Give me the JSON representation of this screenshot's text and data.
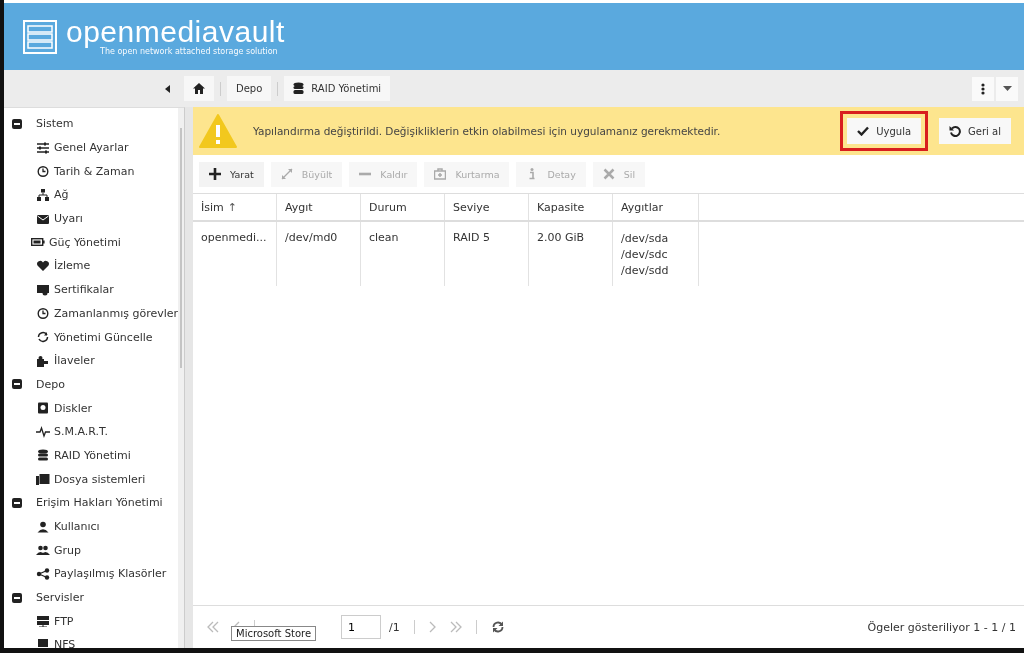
{
  "header": {
    "logo": "openmediavault",
    "tagline": "The open network attached storage solution"
  },
  "breadcrumb": [
    {
      "kind": "home"
    },
    {
      "kind": "text",
      "label": "Depo"
    },
    {
      "kind": "icon",
      "label": "RAID Yönetimi"
    }
  ],
  "sidebar": {
    "groups": [
      {
        "label": "Sistem",
        "expanded": true,
        "children": [
          {
            "label": "Genel Ayarlar"
          },
          {
            "label": "Tarih & Zaman"
          },
          {
            "label": "Ağ"
          },
          {
            "label": "Uyarı"
          },
          {
            "label": "Güç Yönetimi"
          },
          {
            "label": "İzleme"
          },
          {
            "label": "Sertifikalar"
          },
          {
            "label": "Zamanlanmış görevler"
          },
          {
            "label": "Yönetimi Güncelle"
          },
          {
            "label": "İlaveler"
          }
        ]
      },
      {
        "label": "Depo",
        "expanded": true,
        "children": [
          {
            "label": "Diskler"
          },
          {
            "label": "S.M.A.R.T."
          },
          {
            "label": "RAID Yönetimi"
          },
          {
            "label": "Dosya sistemleri"
          }
        ]
      },
      {
        "label": "Erişim Hakları Yönetimi",
        "expanded": true,
        "children": [
          {
            "label": "Kullanıcı"
          },
          {
            "label": "Grup"
          },
          {
            "label": "Paylaşılmış Klasörler"
          }
        ]
      },
      {
        "label": "Servisler",
        "expanded": true,
        "children": [
          {
            "label": "FTP"
          },
          {
            "label": "NFS"
          }
        ]
      }
    ]
  },
  "notice": {
    "message": "Yapılandırma değiştirildi. Değişikliklerin etkin olabilmesi için uygulamanız gerekmektedir.",
    "buttons": [
      {
        "label": "Uygula",
        "highlighted": true
      },
      {
        "label": "Geri al",
        "highlighted": false
      }
    ]
  },
  "toolbar": [
    {
      "label": "Yarat",
      "disabled": false
    },
    {
      "label": "Büyült",
      "disabled": true
    },
    {
      "label": "Kaldır",
      "disabled": true
    },
    {
      "label": "Kurtarma",
      "disabled": true
    },
    {
      "label": "Detay",
      "disabled": true
    },
    {
      "label": "Sil",
      "disabled": true
    }
  ],
  "table": {
    "columns": [
      "İsim",
      "Aygıt",
      "Durum",
      "Seviye",
      "Kapasite",
      "Aygıtlar"
    ],
    "sort_icon": "↑",
    "rows": [
      {
        "cells": [
          "openmedi...",
          "/dev/md0",
          "clean",
          "RAID 5",
          "2.00 GiB",
          [
            "/dev/sda",
            "/dev/sdc",
            "/dev/sdd"
          ]
        ]
      }
    ]
  },
  "pager": {
    "page": "1",
    "total": "/1",
    "summary": "Ögeler gösteriliyor 1 - 1 / 1"
  },
  "tooltip": "Microsoft Store"
}
